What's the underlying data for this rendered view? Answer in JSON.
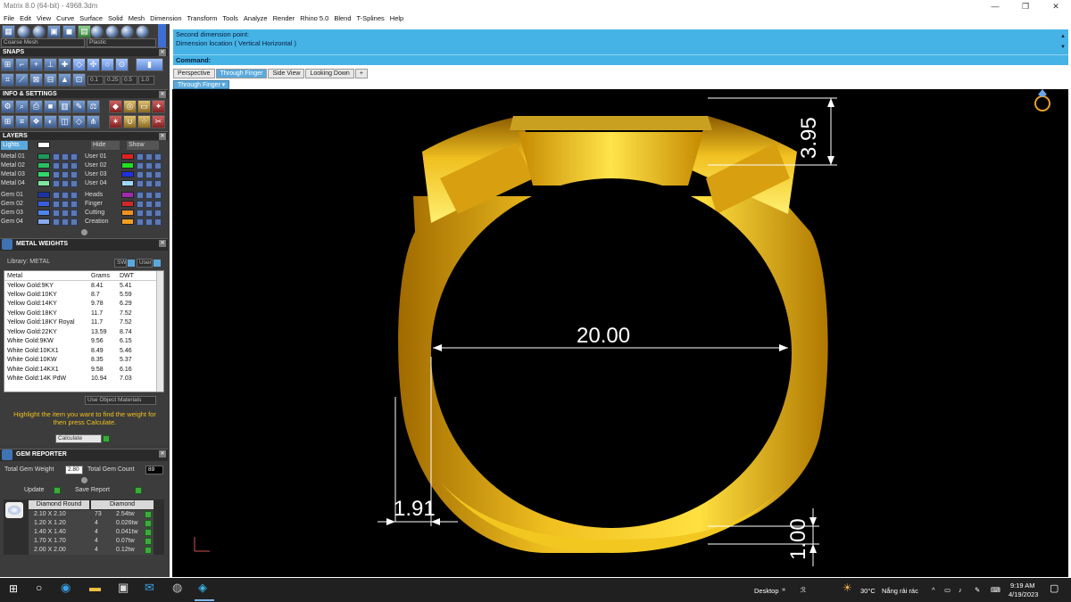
{
  "window": {
    "title": "Matrix 8.0 (64-bit) - 4968.3dm",
    "minimize": "—",
    "restore": "❐",
    "close": "✕"
  },
  "menu": [
    "File",
    "Edit",
    "View",
    "Curve",
    "Surface",
    "Solid",
    "Mesh",
    "Dimension",
    "Transform",
    "Tools",
    "Analyze",
    "Render",
    "Rhino 5.0",
    "Blend",
    "T-Splines",
    "Help"
  ],
  "toolbar": {
    "mesh_select": "Coarse Mesh",
    "material_select": "Plastic"
  },
  "snaps": {
    "title": "SNAPS",
    "values": [
      "0.1",
      "0.25",
      "0.5",
      "1.0"
    ]
  },
  "info": {
    "title": "INFO & SETTINGS"
  },
  "layers": {
    "title": "LAYERS",
    "lights": "Lights",
    "hide": "Hide",
    "show": "Show",
    "left": [
      {
        "name": "Metal 01",
        "color": "#1b9a5a"
      },
      {
        "name": "Metal 02",
        "color": "#27c060"
      },
      {
        "name": "Metal 03",
        "color": "#2fd96a"
      },
      {
        "name": "Metal 04",
        "color": "#7fe6a0"
      },
      {
        "name": "Gem 01",
        "color": "#1b35a8"
      },
      {
        "name": "Gem 02",
        "color": "#3a5de0"
      },
      {
        "name": "Gem 03",
        "color": "#4d84f0"
      },
      {
        "name": "Gem 04",
        "color": "#88aaf0"
      }
    ],
    "right": [
      {
        "name": "User 01",
        "color": "#e02020"
      },
      {
        "name": "User 02",
        "color": "#20e020"
      },
      {
        "name": "User 03",
        "color": "#2030e0"
      },
      {
        "name": "User 04",
        "color": "#9fd8ff"
      },
      {
        "name": "Heads",
        "color": "#a02ab0"
      },
      {
        "name": "Finger",
        "color": "#d02828"
      },
      {
        "name": "Cutting",
        "color": "#f09020"
      },
      {
        "name": "Creation",
        "color": "#f0a020"
      }
    ]
  },
  "metal_weights": {
    "title": "METAL WEIGHTS",
    "library": "Library: METAL",
    "sw": "SW",
    "user": "User",
    "columns": [
      "Metal",
      "Grams",
      "DWT"
    ],
    "rows": [
      [
        "Yellow Gold:9KY",
        "8.41",
        "5.41"
      ],
      [
        "Yellow Gold:10KY",
        "8.7",
        "5.59"
      ],
      [
        "Yellow Gold:14KY",
        "9.78",
        "6.29"
      ],
      [
        "Yellow Gold:18KY",
        "11.7",
        "7.52"
      ],
      [
        "Yellow Gold:18KY Royal",
        "11.7",
        "7.52"
      ],
      [
        "Yellow Gold:22KY",
        "13.59",
        "8.74"
      ],
      [
        "White Gold:9KW",
        "9.56",
        "6.15"
      ],
      [
        "White Gold:10KX1",
        "8.49",
        "5.46"
      ],
      [
        "White Gold:10KW",
        "8.35",
        "5.37"
      ],
      [
        "White Gold:14KX1",
        "9.58",
        "6.16"
      ],
      [
        "White Gold:14K PdW",
        "10.94",
        "7.03"
      ]
    ],
    "use_object_materials": "Use Object Materials",
    "hint": "Highlight the item you want to find the weight for then press Calculate.",
    "calculate": "Calculate"
  },
  "gem_reporter": {
    "title": "GEM REPORTER",
    "total_weight_label": "Total Gem Weight",
    "total_weight": "2.80",
    "total_count_label": "Total Gem Count",
    "total_count": "89",
    "update": "Update",
    "save_report": "Save Report",
    "col_shape": "Diamond Round",
    "col_type": "Diamond",
    "rows": [
      [
        "2.10 X 2.10",
        "73",
        "2.54tw"
      ],
      [
        "1.20 X 1.20",
        "4",
        "0.026tw"
      ],
      [
        "1.40 X 1.40",
        "4",
        "0.041tw"
      ],
      [
        "1.70 X 1.70",
        "4",
        "0.07tw"
      ],
      [
        "2.00 X 2.00",
        "4",
        "0.12tw"
      ]
    ]
  },
  "command": {
    "line1": "Second dimension point:",
    "line2": "Dimension location ( Vertical  Horizontal )",
    "prompt": "Command:"
  },
  "viewport_tabs": [
    "Perspective",
    "Through Finger",
    "Side View",
    "Looking Down",
    "+"
  ],
  "active_tab": "Through Finger",
  "sub_tab": "Through Finger",
  "dimensions": {
    "inner": "20.00",
    "top": "3.95",
    "side": "1.91",
    "bottom": "1.00"
  },
  "taskbar": {
    "desktop": "Desktop",
    "weather_temp": "30°C",
    "weather_text": "Nắng rải rác",
    "time": "9:19 AM",
    "date": "4/19/2023"
  }
}
